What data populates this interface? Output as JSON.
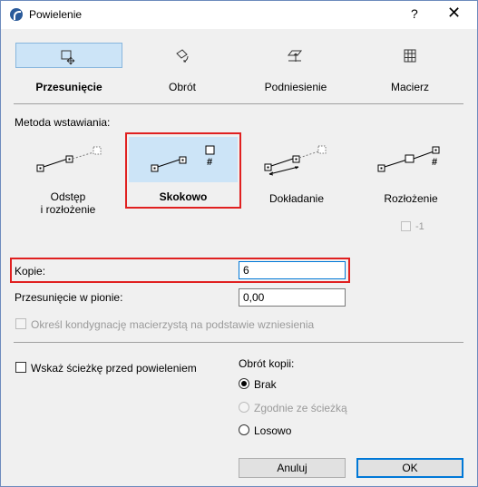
{
  "window": {
    "title": "Powielenie",
    "help": "?",
    "close": "✕"
  },
  "tabs": [
    {
      "label": "Przesunięcie",
      "icon": "move-icon"
    },
    {
      "label": "Obrót",
      "icon": "rotate-icon"
    },
    {
      "label": "Podniesienie",
      "icon": "elevate-icon"
    },
    {
      "label": "Macierz",
      "icon": "matrix-icon"
    }
  ],
  "method": {
    "label": "Metoda wstawiania:",
    "options": [
      {
        "line1": "Odstęp",
        "line2": "i rozłożenie"
      },
      {
        "line1": "Skokowo"
      },
      {
        "line1": "Dokładanie"
      },
      {
        "line1": "Rozłożenie"
      }
    ],
    "minus_one": "-1"
  },
  "fields": {
    "copies_label": "Kopie:",
    "copies_value": "6",
    "vertical_label": "Przesunięcie w pionie:",
    "vertical_value": "0,00",
    "story_label": "Określ kondygnację macierzystą na podstawie wzniesienia"
  },
  "path": {
    "label": "Wskaż ścieżkę przed powieleniem"
  },
  "rotation": {
    "label": "Obrót kopii:",
    "options": [
      "Brak",
      "Zgodnie ze ścieżką",
      "Losowo"
    ]
  },
  "buttons": {
    "cancel": "Anuluj",
    "ok": "OK"
  },
  "colors": {
    "selected_bg": "#cce4f7",
    "highlight": "#e02020",
    "ok_border": "#0078d7"
  }
}
